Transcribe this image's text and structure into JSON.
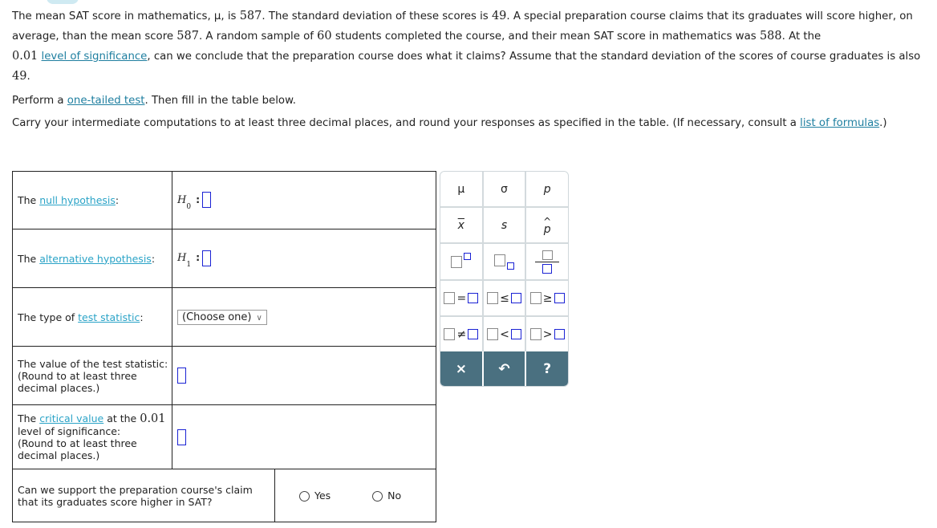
{
  "problem": {
    "intro_1": "The mean SAT score in mathematics, μ, is ",
    "mu_value": "587",
    "intro_2": ". The standard deviation of these scores is ",
    "sd_value": "49",
    "intro_3": ". A special preparation course claims that its graduates will score higher, on average, than the mean score ",
    "mean_value_2": "587",
    "intro_4": ". A random sample of ",
    "sample_size": "60",
    "intro_5": " students completed the course, and their mean SAT score in mathematics was ",
    "sample_mean": "588",
    "intro_6": ". At the ",
    "alpha": "0.01",
    "link_level_of_significance": "level of significance",
    "intro_7": ", can we conclude that the preparation course does what it claims? Assume that the standard deviation of the scores of course graduates is also ",
    "sd_value_2": "49",
    "intro_8": "."
  },
  "instructions": {
    "perform_prefix": "Perform a ",
    "link_one_tailed": "one-tailed test",
    "perform_suffix": ". Then fill in the table below.",
    "carry_text": "Carry your intermediate computations to at least three decimal places, and round your responses as specified in the table. (If necessary, consult a ",
    "link_formulas": "list of formulas",
    "carry_suffix": ".)"
  },
  "table": {
    "the": "The ",
    "null_link": "null hypothesis",
    "alt_link": "alternative hypothesis",
    "colon": ":",
    "h": "H",
    "h0_sub": "0",
    "h1_sub": "1",
    "type_prefix": "The type of ",
    "test_stat_link": "test statistic",
    "select_value": "(Choose one)",
    "value_label_1": "The value of the test statistic:",
    "value_label_2": "(Round to at least three",
    "value_label_3": "decimal places.)",
    "critical_link": "critical value",
    "critical_mid": " at the ",
    "critical_alpha": "0.01",
    "critical_label_2": "level of significance:",
    "critical_label_3": "(Round to at least three",
    "critical_label_4": "decimal places.)",
    "claim_q_1": "Can we support the preparation course's claim",
    "claim_q_2": "that its graduates score higher in SAT?",
    "yes": "Yes",
    "no": "No"
  },
  "keypad": {
    "mu": "μ",
    "sigma": "σ",
    "p": "p",
    "xbar": "x",
    "s": "s",
    "phat": "p",
    "eq": "=",
    "le": "≤",
    "ge": "≥",
    "ne": "≠",
    "lt": "<",
    "gt": ">",
    "clear": "×",
    "undo": "↶",
    "help": "?"
  }
}
